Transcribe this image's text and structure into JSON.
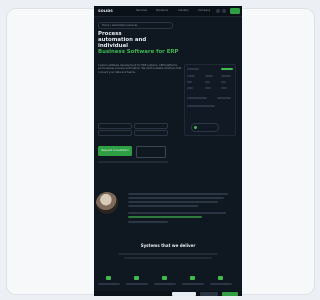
{
  "site": {
    "logo": "SOLIDS",
    "nav_links": [
      "Services",
      "Solutions",
      "Industry",
      "Company"
    ],
    "breadcrumb": "Home / Automation services",
    "hero": {
      "title_lines": [
        "Process",
        "automation and",
        "individual"
      ],
      "title_green": "Business Software for ERP",
      "lead": "Custom software development for ERP systems, CRM platforms and business process automation. We build scalable solutions that connect your data and teams."
    },
    "primary_button": "Request consultation",
    "section_title": "Systems that we deliver"
  },
  "colors": {
    "page_bg": "#eceff3",
    "site_bg": "#0f1720",
    "accent": "#3fb950",
    "text": "#e6edf3"
  }
}
